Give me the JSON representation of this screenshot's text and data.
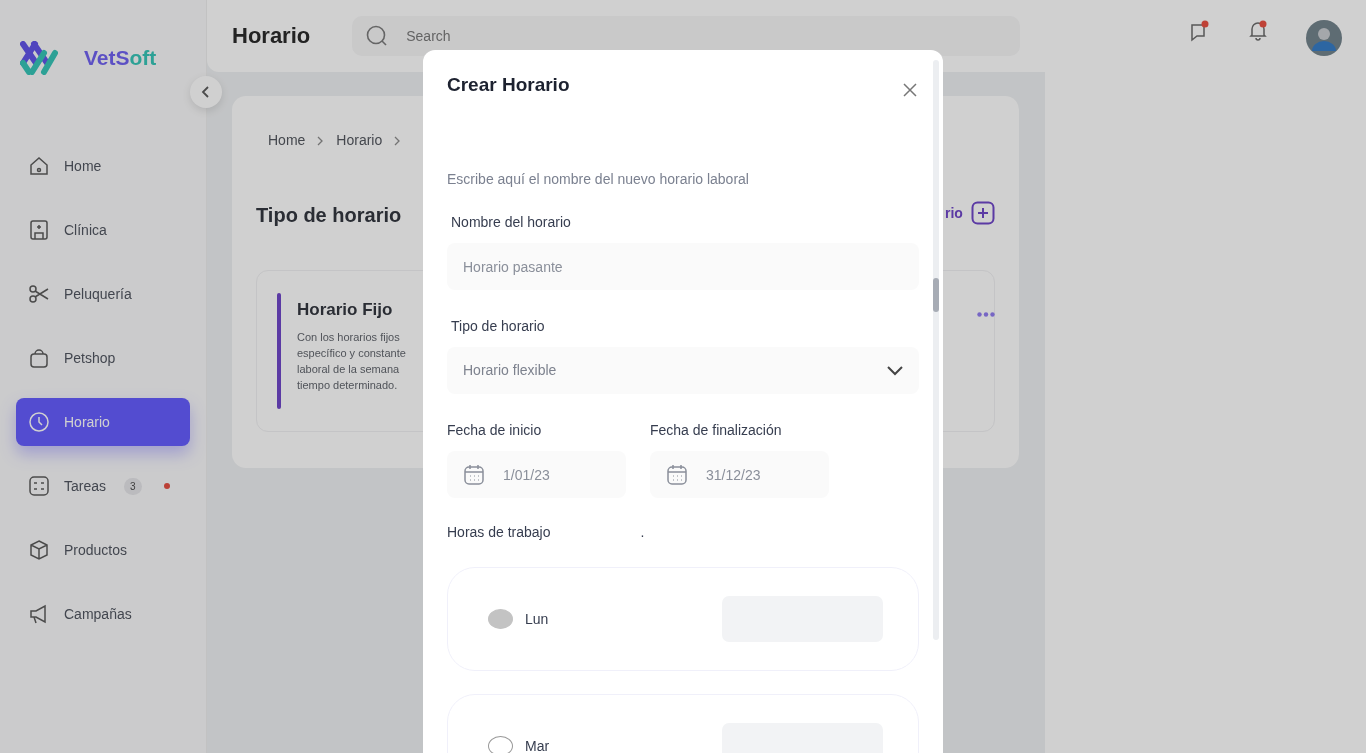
{
  "brand": {
    "name": "VetSoft"
  },
  "sidebar": {
    "items": [
      {
        "label": "Home",
        "selected": false
      },
      {
        "label": "Clínica",
        "selected": false
      },
      {
        "label": "Peluquería",
        "selected": false
      },
      {
        "label": "Petshop",
        "selected": false
      },
      {
        "label": "Horario",
        "selected": true
      },
      {
        "label": "Tareas",
        "selected": false,
        "badge": "3",
        "unread": true
      },
      {
        "label": "Productos",
        "selected": false
      },
      {
        "label": "Campañas",
        "selected": false
      }
    ]
  },
  "header": {
    "title": "Horario",
    "search": {
      "placeholder": "Search"
    }
  },
  "breadcrumb": [
    "Home",
    "Horario"
  ],
  "page": {
    "title": "Tipo de horario",
    "add_button": "rio",
    "card": {
      "title": "Horario Fijo",
      "lines": [
        "Con los horarios fijos",
        "específico y constante",
        "laboral de la semana",
        "tiempo determinado."
      ]
    }
  },
  "modal": {
    "title": "Crear Horario",
    "description": "Escribe aquí el nombre del nuevo horario laboral",
    "name_field": {
      "label": "Nombre del horario",
      "placeholder": "Horario pasante"
    },
    "type_field": {
      "label": "Tipo de horario",
      "value": "Horario flexible"
    },
    "start_date": {
      "label": "Fecha de inicio",
      "placeholder": "1/01/23"
    },
    "end_date": {
      "label": "Fecha de finalización",
      "placeholder": "31/12/23"
    },
    "hours": {
      "label": "Horas de trabajo",
      "note": "."
    },
    "days": [
      {
        "label": "Lun",
        "on": true
      },
      {
        "label": "Mar",
        "on": false
      }
    ]
  }
}
